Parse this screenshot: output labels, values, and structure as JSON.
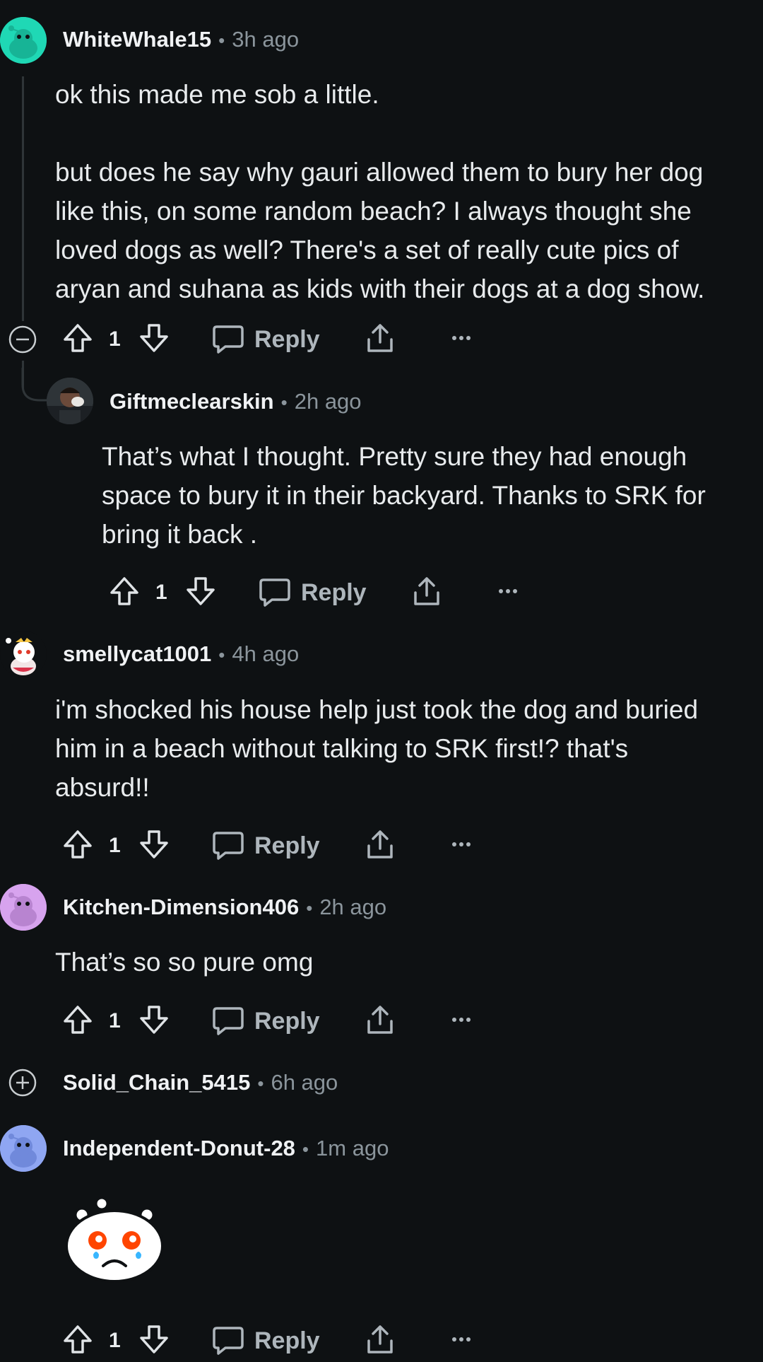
{
  "comments": [
    {
      "username": "WhiteWhale15",
      "time": "3h ago",
      "body": "ok this made me sob a little.\n\nbut does he say why gauri allowed them to bury her dog\nlike this, on some random beach? I always thought she\nloved dogs as well? There's a set of really cute pics of\naryan and suhana as kids with their dogs at a dog show.",
      "votes": "1",
      "reply_label": "Reply",
      "avatar_color": "#1fd8b5"
    },
    {
      "username": "Giftmeclearskin",
      "time": "2h ago",
      "body": "That’s what I thought. Pretty sure they had enough\nspace to bury it in their backyard. Thanks to SRK for\nbring it back .",
      "votes": "1",
      "reply_label": "Reply"
    },
    {
      "username": "smellycat1001",
      "time": "4h ago",
      "body": "i'm shocked his house help just took the dog and buried\nhim in a beach without talking to SRK first!? that's\nabsurd!!",
      "votes": "1",
      "reply_label": "Reply"
    },
    {
      "username": "Kitchen-Dimension406",
      "time": "2h ago",
      "body": "That’s so so pure omg",
      "votes": "1",
      "reply_label": "Reply",
      "avatar_color": "#d7a3ee"
    },
    {
      "username": "Solid_Chain_5415",
      "time": "6h ago",
      "collapsed": true
    },
    {
      "username": "Independent-Donut-28",
      "time": "1m ago",
      "body_emote": "crying-snoo-emote",
      "votes": "1",
      "reply_label": "Reply",
      "avatar_color": "#8fa6f2"
    }
  ],
  "theme": {
    "background": "#0e1113",
    "text": "#e8ebed",
    "muted": "#8b959c",
    "thread_line": "#2f3538"
  }
}
